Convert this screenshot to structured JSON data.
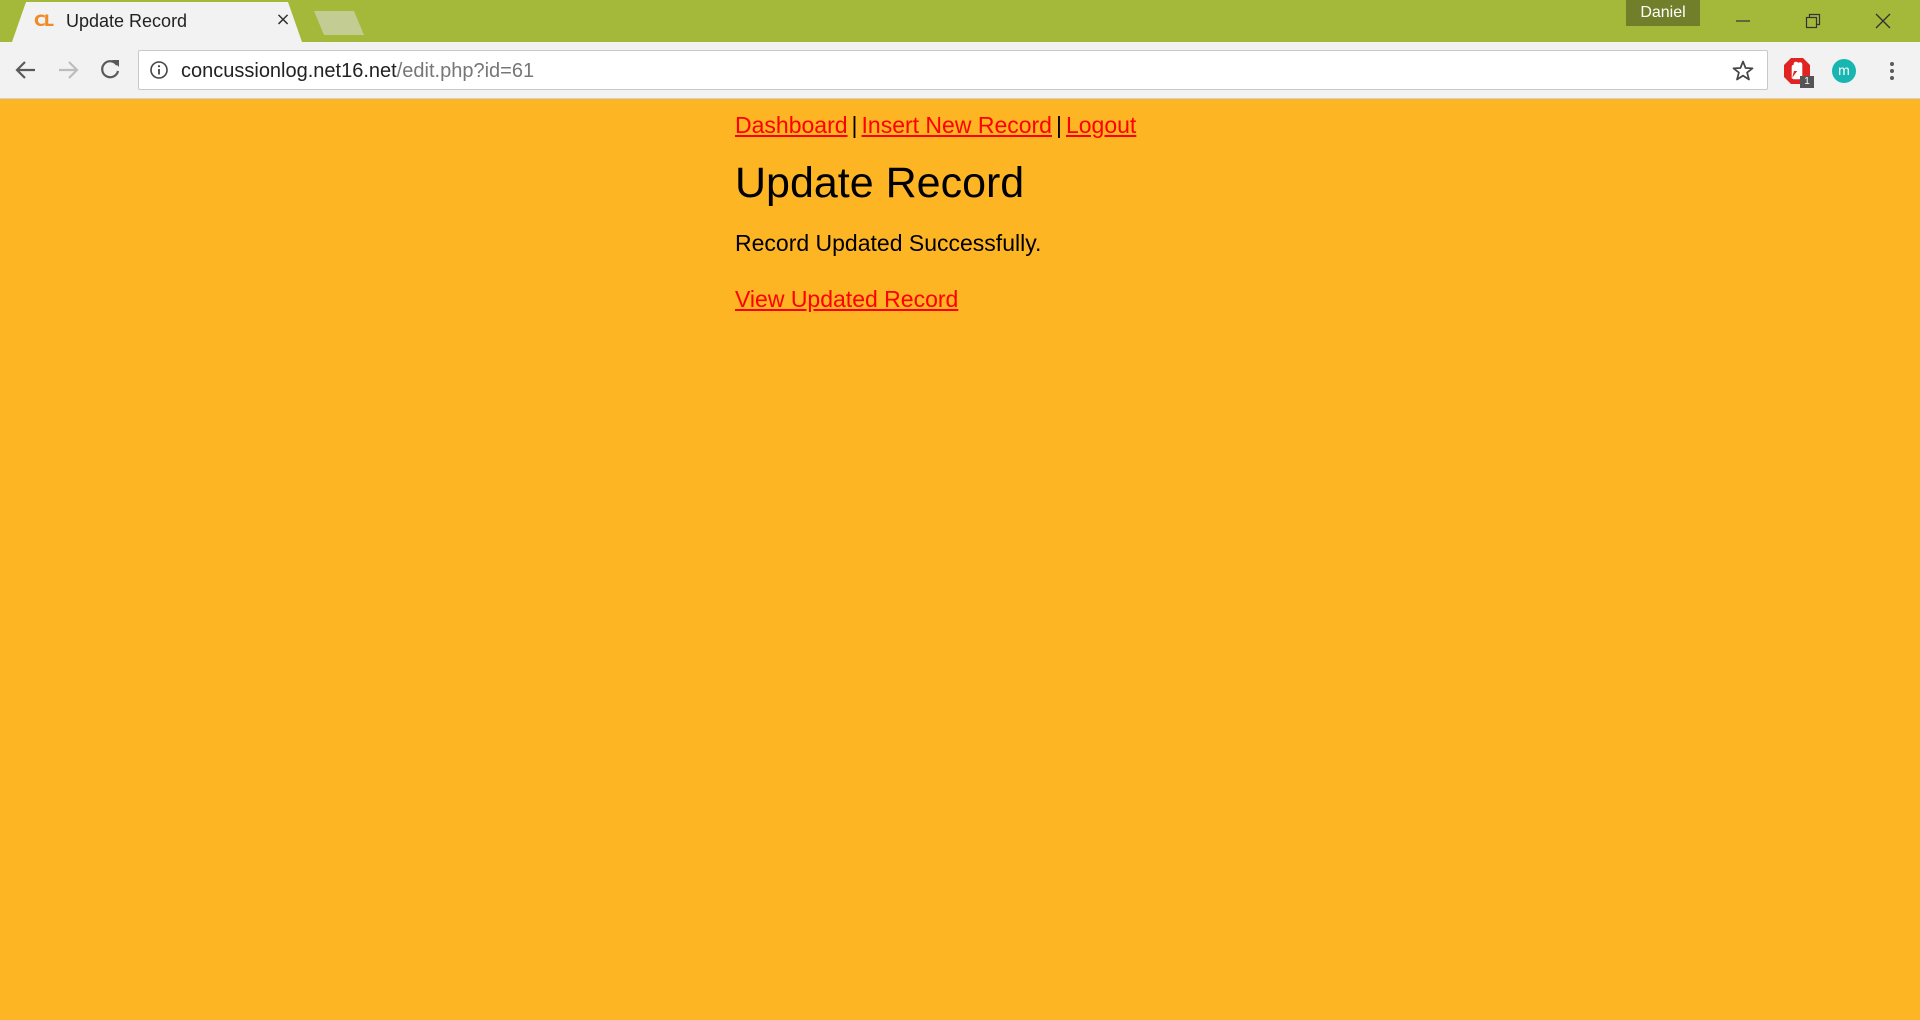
{
  "browser": {
    "tab_title": "Update Record",
    "tab_favicon_text": "CL",
    "tab_close_glyph": "×",
    "profile_name": "Daniel",
    "url_host": "concussionlog.net16.net",
    "url_path": "/edit.php?id=61",
    "extension_badge_count": "1",
    "extension_m_label": "m",
    "colors": {
      "titlebar": "#A4B83A",
      "tab": "#F2F2F2",
      "profile": "#717F2A",
      "adblock": "#E02424",
      "extension_m": "#19B5B0"
    }
  },
  "page": {
    "background": "#FEB524",
    "link_color": "#FF0000",
    "nav": {
      "dashboard": "Dashboard",
      "insert": "Insert New Record",
      "logout": "Logout",
      "separator": "|"
    },
    "heading": "Update Record",
    "message": "Record Updated Successfully.",
    "view_link": "View Updated Record"
  },
  "icons": {
    "back": "arrow-left-icon",
    "forward": "arrow-right-icon",
    "reload": "reload-icon",
    "info": "info-icon",
    "star": "star-icon",
    "adblock": "adblock-hand-icon",
    "menu": "kebab-menu-icon",
    "minimize": "minimize-icon",
    "restore": "restore-icon",
    "close": "close-icon"
  }
}
